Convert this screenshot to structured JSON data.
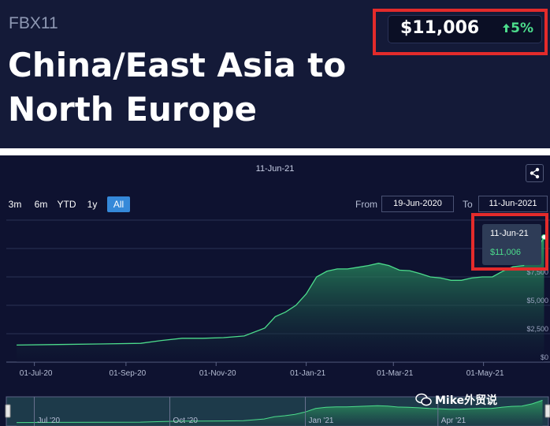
{
  "header": {
    "ticker": "FBX11",
    "title": "China/East Asia to North Europe",
    "price": "$11,006",
    "change": "5%",
    "change_icon": "arrow-up-icon"
  },
  "chart": {
    "selected_date": "11-Jun-21",
    "range_buttons": [
      "3m",
      "6m",
      "YTD",
      "1y",
      "All"
    ],
    "active_range": "All",
    "from_label": "From",
    "from_value": "19-Jun-2020",
    "to_label": "To",
    "to_value": "11-Jun-2021",
    "share_icon": "share-icon"
  },
  "tooltip": {
    "date": "11-Jun-21",
    "value": "$11,006"
  },
  "watermark": {
    "text": "Mike外贸说",
    "icon": "wechat-icon"
  },
  "colors": {
    "background": "#0e1230",
    "header": "#141a38",
    "line": "#4cdc8c",
    "highlight": "#e32b2b",
    "active_button": "#3589d9"
  },
  "chart_data": {
    "type": "area",
    "y_tick_labels": [
      "$0",
      "$2,500",
      "$5,000",
      "$7,500"
    ],
    "ylim": [
      0,
      12500
    ],
    "x_tick_labels": [
      "01-Jul-20",
      "01-Sep-20",
      "01-Nov-20",
      "01-Jan-21",
      "01-Mar-21",
      "01-May-21"
    ],
    "x": [
      "2020-06-19",
      "2020-07-17",
      "2020-08-14",
      "2020-09-11",
      "2020-09-25",
      "2020-10-09",
      "2020-10-23",
      "2020-11-06",
      "2020-11-20",
      "2020-12-04",
      "2020-12-11",
      "2020-12-18",
      "2020-12-25",
      "2021-01-01",
      "2021-01-08",
      "2021-01-15",
      "2021-01-22",
      "2021-01-29",
      "2021-02-05",
      "2021-02-12",
      "2021-02-19",
      "2021-02-26",
      "2021-03-05",
      "2021-03-12",
      "2021-03-19",
      "2021-03-26",
      "2021-04-02",
      "2021-04-09",
      "2021-04-16",
      "2021-04-23",
      "2021-04-30",
      "2021-05-07",
      "2021-05-14",
      "2021-05-21",
      "2021-05-28",
      "2021-06-04",
      "2021-06-11"
    ],
    "values": [
      1500,
      1550,
      1600,
      1650,
      1900,
      2100,
      2100,
      2150,
      2300,
      3000,
      4000,
      4400,
      5000,
      6000,
      7500,
      8000,
      8200,
      8200,
      8350,
      8500,
      8700,
      8500,
      8100,
      8050,
      7800,
      7500,
      7400,
      7200,
      7200,
      7400,
      7500,
      7500,
      8000,
      8400,
      8500,
      9500,
      11006
    ],
    "navigator_tick_labels": [
      "Jul '20",
      "Oct '20",
      "Jan '21",
      "Apr '21"
    ],
    "grid": true
  }
}
